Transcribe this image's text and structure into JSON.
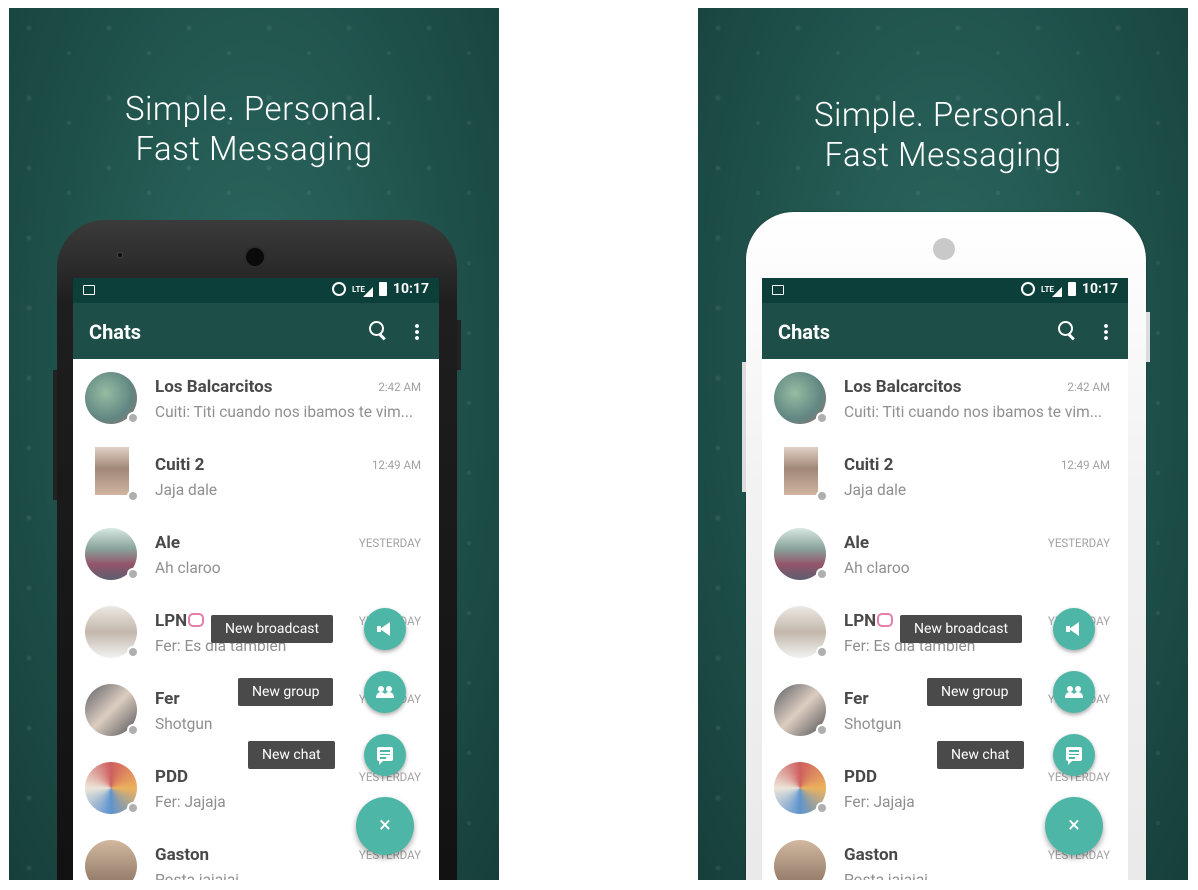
{
  "headline": {
    "line1": "Simple. Personal.",
    "line2": "Fast Messaging"
  },
  "status_bar": {
    "network": "LTE",
    "time": "10:17"
  },
  "app_bar": {
    "title": "Chats"
  },
  "chats": [
    {
      "name": "Los Balcarcitos",
      "message": "Cuiti: Titi cuando nos ibamos te vim...",
      "time": "2:42 AM"
    },
    {
      "name": "Cuiti 2",
      "message": "Jaja dale",
      "time": "12:49 AM"
    },
    {
      "name": "Ale",
      "message": "Ah claroo",
      "time": "YESTERDAY"
    },
    {
      "name": "LPN",
      "message": "Fer: Es dia tambien",
      "time": "YESTERDAY"
    },
    {
      "name": "Fer",
      "message": "Shotgun",
      "time": "YESTERDAY"
    },
    {
      "name": "PDD",
      "message": "Fer: Jajaja",
      "time": "YESTERDAY"
    },
    {
      "name": "Gaston",
      "message": "Posta jajajaj",
      "time": "YESTERDAY"
    }
  ],
  "fab_menu": {
    "broadcast": "New broadcast",
    "group": "New group",
    "chat": "New chat",
    "close": "×"
  },
  "colors": {
    "appbar": "#1d4f48",
    "statusbar": "#0c3f3a",
    "fab": "#4db6a6"
  }
}
